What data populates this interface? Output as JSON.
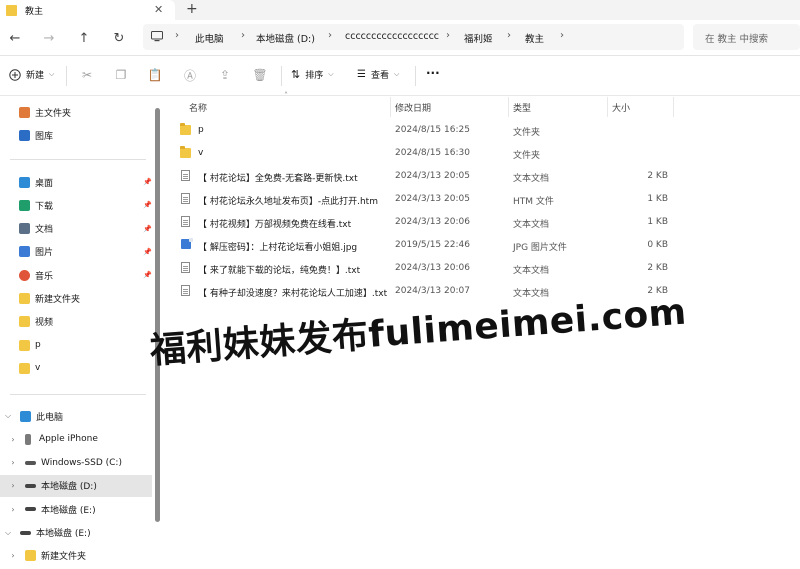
{
  "tab": {
    "title": "教主",
    "close": "✕",
    "new": "+"
  },
  "nav": {
    "back": "←",
    "forward": "→",
    "up": "↑",
    "refresh": "↻",
    "breadcrumb": [
      "此电脑",
      "本地磁盘 (D:)",
      "cccccccccccccccccc",
      "福利姬",
      "教主"
    ],
    "chevron": "›",
    "search_placeholder": "在 教主 中搜索"
  },
  "toolbar": {
    "new_label": "新建",
    "sort_label": "排序",
    "view_label": "查看",
    "more": "···"
  },
  "sidebar": {
    "quick": [
      {
        "label": "主文件夹",
        "icon": "home-icon"
      },
      {
        "label": "图库",
        "icon": "gallery-icon"
      }
    ],
    "pinned": [
      {
        "label": "桌面",
        "icon": "desktop-icon",
        "pinned": true
      },
      {
        "label": "下载",
        "icon": "download-icon",
        "pinned": true
      },
      {
        "label": "文档",
        "icon": "documents-icon",
        "pinned": true
      },
      {
        "label": "图片",
        "icon": "pictures-icon",
        "pinned": true
      },
      {
        "label": "音乐",
        "icon": "music-icon",
        "pinned": true
      },
      {
        "label": "新建文件夹",
        "icon": "folder-icon",
        "pinned": false
      },
      {
        "label": "视频",
        "icon": "folder-icon",
        "pinned": false
      },
      {
        "label": "p",
        "icon": "folder-icon",
        "pinned": false
      },
      {
        "label": "v",
        "icon": "folder-icon",
        "pinned": false
      }
    ],
    "tree": [
      {
        "label": "此电脑",
        "icon": "computer-icon",
        "expanded": true,
        "level": 0
      },
      {
        "label": "Apple iPhone",
        "icon": "phone-icon",
        "expanded": false,
        "level": 1
      },
      {
        "label": "Windows-SSD (C:)",
        "icon": "drive-c-icon",
        "expanded": false,
        "level": 1
      },
      {
        "label": "本地磁盘 (D:)",
        "icon": "drive-icon",
        "expanded": false,
        "level": 1,
        "selected": true
      },
      {
        "label": "本地磁盘 (E:)",
        "icon": "drive-icon",
        "expanded": false,
        "level": 1
      },
      {
        "label": "本地磁盘 (E:)",
        "icon": "drive-icon",
        "expanded": true,
        "level": 0
      },
      {
        "label": "新建文件夹",
        "icon": "folder-icon",
        "expanded": false,
        "level": 1
      }
    ]
  },
  "columns": {
    "name": "名称",
    "date": "修改日期",
    "type": "类型",
    "size": "大小"
  },
  "files": [
    {
      "name": "p",
      "date": "2024/8/15 16:25",
      "type": "文件夹",
      "size": "",
      "kind": "folder"
    },
    {
      "name": "v",
      "date": "2024/8/15 16:30",
      "type": "文件夹",
      "size": "",
      "kind": "folder"
    },
    {
      "name": "【 村花论坛】全免费-无套路-更新快.txt",
      "date": "2024/3/13 20:05",
      "type": "文本文档",
      "size": "2 KB",
      "kind": "doc"
    },
    {
      "name": "【 村花论坛永久地址发布页】-点此打开.htm",
      "date": "2024/3/13 20:05",
      "type": "HTM 文件",
      "size": "1 KB",
      "kind": "doc"
    },
    {
      "name": "【 村花视频】万部视频免费在线看.txt",
      "date": "2024/3/13 20:06",
      "type": "文本文档",
      "size": "1 KB",
      "kind": "doc"
    },
    {
      "name": "【 解压密码】：上村花论坛看小姐姐.jpg",
      "date": "2019/5/15 22:46",
      "type": "JPG 图片文件",
      "size": "0 KB",
      "kind": "img"
    },
    {
      "name": "【 来了就能下载的论坛，纯免费！】.txt",
      "date": "2024/3/13 20:06",
      "type": "文本文档",
      "size": "2 KB",
      "kind": "doc"
    },
    {
      "name": "【 有种子却没速度？来村花论坛人工加速】.txt",
      "date": "2024/3/13 20:07",
      "type": "文本文档",
      "size": "2 KB",
      "kind": "doc"
    }
  ],
  "watermark": "福利妹妹发布fulimeimei.com",
  "colors": {
    "folder": "#f2c744",
    "selected": "#e5e5e5",
    "accent": "#005fb8"
  }
}
